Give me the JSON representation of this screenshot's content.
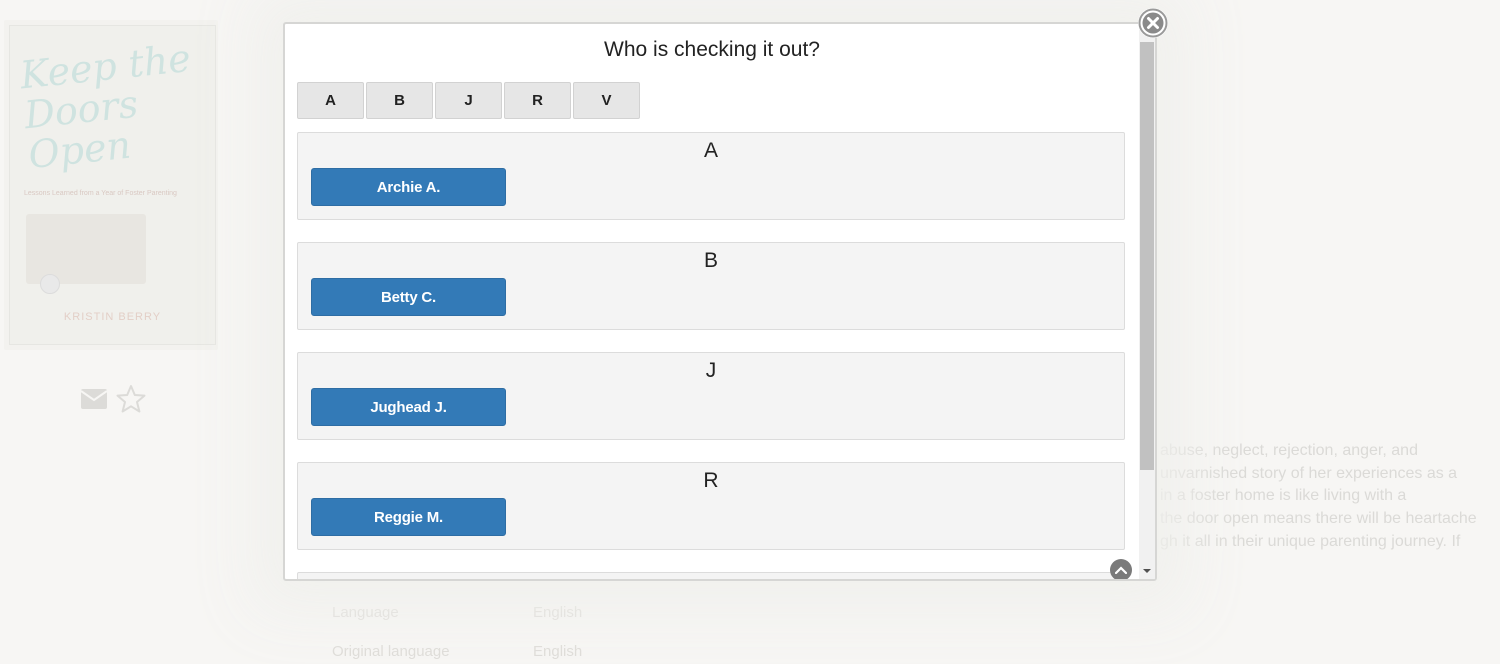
{
  "background": {
    "book": {
      "title": "Keep the Doors Open",
      "subtitle": "Lessons Learned from a Year of Foster Parenting",
      "author": "KRISTIN BERRY"
    },
    "icons": [
      "envelope-icon",
      "star-icon"
    ],
    "description_lines": [
      "abuse, neglect, rejection, anger, and",
      "unvarnished story of her experiences as a",
      "in a foster home is like living with a",
      "the door open means there will be heartache",
      "gh it all in their unique parenting journey. If"
    ],
    "meta": [
      {
        "label": "Language",
        "value": "English"
      },
      {
        "label": "Original language",
        "value": "English"
      }
    ]
  },
  "modal": {
    "title": "Who is checking it out?",
    "letters": [
      "A",
      "B",
      "J",
      "R",
      "V"
    ],
    "groups": [
      {
        "letter": "A",
        "people": [
          "Archie A."
        ]
      },
      {
        "letter": "B",
        "people": [
          "Betty C."
        ]
      },
      {
        "letter": "J",
        "people": [
          "Jughead J."
        ]
      },
      {
        "letter": "R",
        "people": [
          "Reggie M."
        ]
      }
    ],
    "close_icon": "close-icon",
    "scroll_top_icon": "chevron-up-icon"
  },
  "colors": {
    "primary_button": "#337ab7",
    "letter_button": "#e6e6e6",
    "group_background": "#f4f4f4"
  }
}
